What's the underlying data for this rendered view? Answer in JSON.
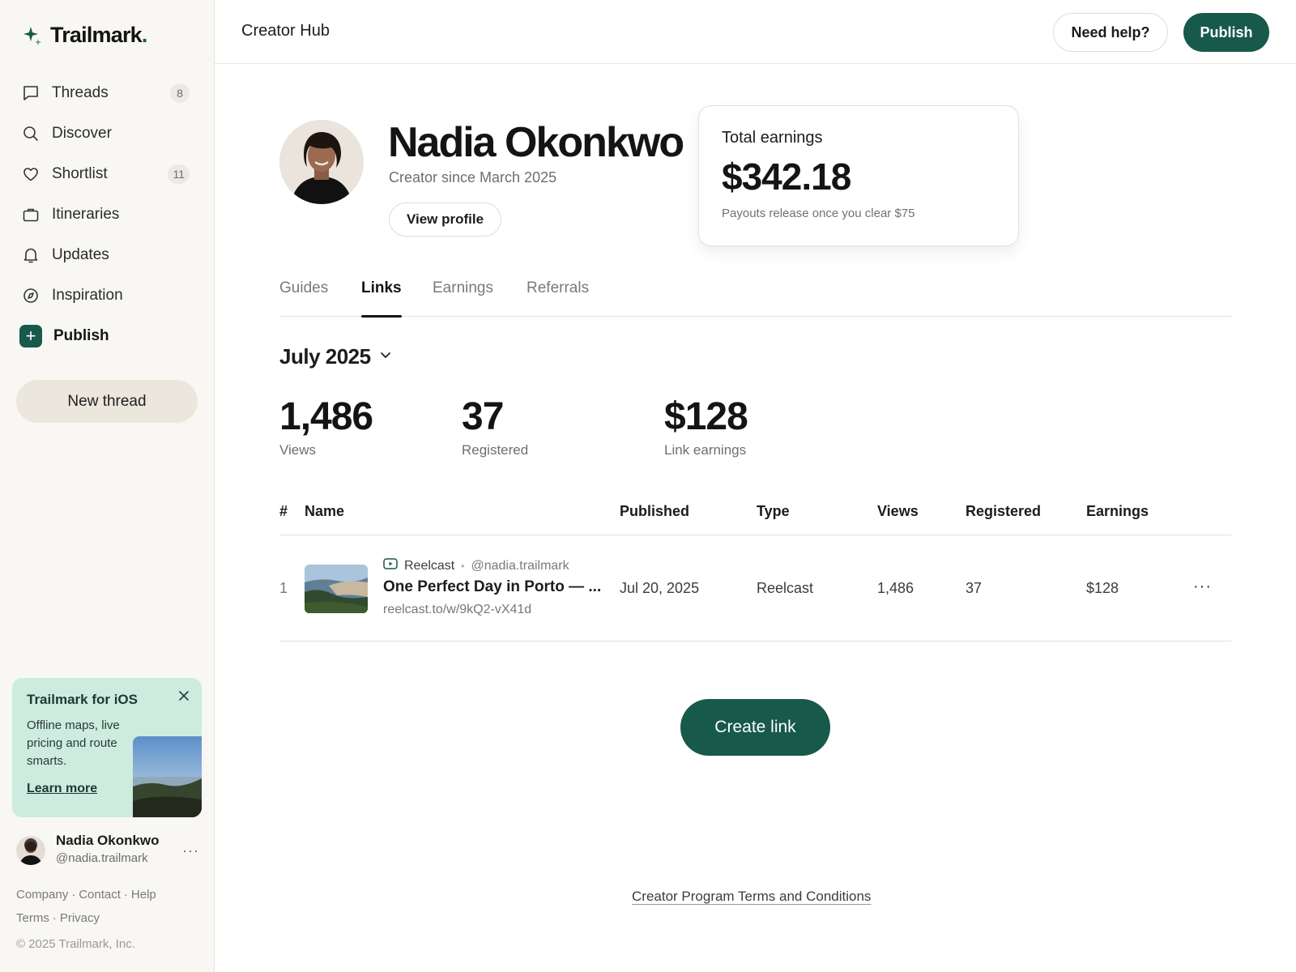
{
  "brand": {
    "name": "Trailmark",
    "dot": ".",
    "accent": "#17594a"
  },
  "sidebar": {
    "items": [
      {
        "label": "Threads",
        "count": "8",
        "icon": "chat-bubble-icon"
      },
      {
        "label": "Discover",
        "count": "",
        "icon": "search-icon"
      },
      {
        "label": "Shortlist",
        "count": "11",
        "icon": "heart-icon"
      },
      {
        "label": "Itineraries",
        "count": "",
        "icon": "briefcase-icon"
      },
      {
        "label": "Updates",
        "count": "",
        "icon": "bell-icon"
      },
      {
        "label": "Inspiration",
        "count": "",
        "icon": "compass-icon"
      }
    ],
    "publish_label": "Publish",
    "new_thread": "New thread",
    "promo": {
      "title": "Trailmark for iOS",
      "text": "Offline maps, live pricing and route smarts.",
      "link": "Learn more"
    },
    "user": {
      "name": "Nadia Okonkwo",
      "handle": "@nadia.trailmark"
    },
    "footer_links": [
      "Company",
      "Contact",
      "Help",
      "Terms",
      "Privacy"
    ],
    "copyright": "© 2025 Trailmark, Inc."
  },
  "header": {
    "title": "Creator Hub",
    "help_label": "Need help?",
    "publish_label": "Publish"
  },
  "profile": {
    "name": "Nadia Okonkwo",
    "since": "Creator since March 2025",
    "view_label": "View profile"
  },
  "earnings_card": {
    "title": "Total earnings",
    "value": "$342.18",
    "note": "Payouts release once you clear $75"
  },
  "tabs": [
    {
      "label": "Guides",
      "active": false
    },
    {
      "label": "Links",
      "active": true
    },
    {
      "label": "Earnings",
      "active": false
    },
    {
      "label": "Referrals",
      "active": false
    }
  ],
  "period": "July 2025",
  "stats": [
    {
      "value": "1,486",
      "label": "Views"
    },
    {
      "value": "37",
      "label": "Registered"
    },
    {
      "value": "$128",
      "label": "Link earnings"
    }
  ],
  "table": {
    "columns": [
      "#",
      "Name",
      "Published",
      "Type",
      "Views",
      "Registered",
      "Earnings"
    ],
    "rows": [
      {
        "index": "1",
        "source": "Reelcast",
        "handle": "@nadia.trailmark",
        "title": "One Perfect Day in Porto — ...",
        "url": "reelcast.to/w/9kQ2-vX41d",
        "published": "Jul 20, 2025",
        "type": "Reelcast",
        "views": "1,486",
        "registered": "37",
        "earnings": "$128",
        "more": "···"
      }
    ]
  },
  "create_link": "Create link",
  "terms": "Creator Program Terms and Conditions"
}
